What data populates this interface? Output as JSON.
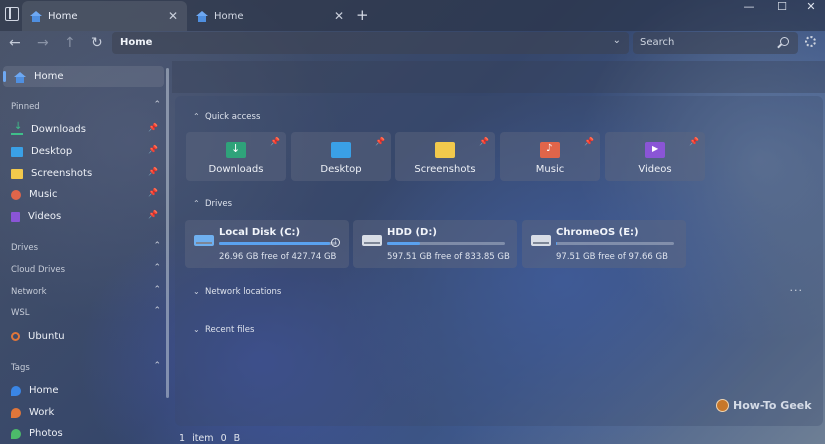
{
  "tabs": [
    {
      "label": "Home",
      "active": true
    },
    {
      "label": "Home",
      "active": false
    }
  ],
  "address": {
    "path": "Home"
  },
  "search": {
    "placeholder": "Search"
  },
  "sidebar": {
    "home": "Home",
    "pinned_header": "Pinned",
    "pinned": [
      {
        "label": "Downloads",
        "icon": "download-icon"
      },
      {
        "label": "Desktop",
        "icon": "desktop-icon"
      },
      {
        "label": "Screenshots",
        "icon": "folder-icon"
      },
      {
        "label": "Music",
        "icon": "music-icon"
      },
      {
        "label": "Videos",
        "icon": "video-icon"
      }
    ],
    "drives_header": "Drives",
    "cloud_header": "Cloud Drives",
    "network_header": "Network",
    "wsl_header": "WSL",
    "wsl_item": "Ubuntu",
    "tags_header": "Tags",
    "tags": [
      {
        "label": "Home",
        "color": "#3a86e6"
      },
      {
        "label": "Work",
        "color": "#e0763a"
      },
      {
        "label": "Photos",
        "color": "#4cbb6a"
      }
    ]
  },
  "main": {
    "quick_access_header": "Quick access",
    "quick_access": [
      {
        "label": "Downloads",
        "color": "#2fa37a"
      },
      {
        "label": "Desktop",
        "color": "#3aa0e6"
      },
      {
        "label": "Screenshots",
        "color": "#f2c94c"
      },
      {
        "label": "Music",
        "color": "#e0654a"
      },
      {
        "label": "Videos",
        "color": "#8a55d6"
      }
    ],
    "drives_header": "Drives",
    "drives": [
      {
        "name": "Local Disk (C:)",
        "free": "26.96 GB free of 427.74 GB",
        "used_fraction": 0.937
      },
      {
        "name": "HDD (D:)",
        "free": "597.51 GB free of 833.85 GB",
        "used_fraction": 0.283
      },
      {
        "name": "ChromeOS (E:)",
        "free": "97.51 GB free of 97.66 GB",
        "used_fraction": 0.002
      }
    ],
    "network_header": "Network locations",
    "recent_header": "Recent files"
  },
  "status": {
    "count": "1 item",
    "size": "0 B"
  },
  "watermark": "How-To Geek"
}
